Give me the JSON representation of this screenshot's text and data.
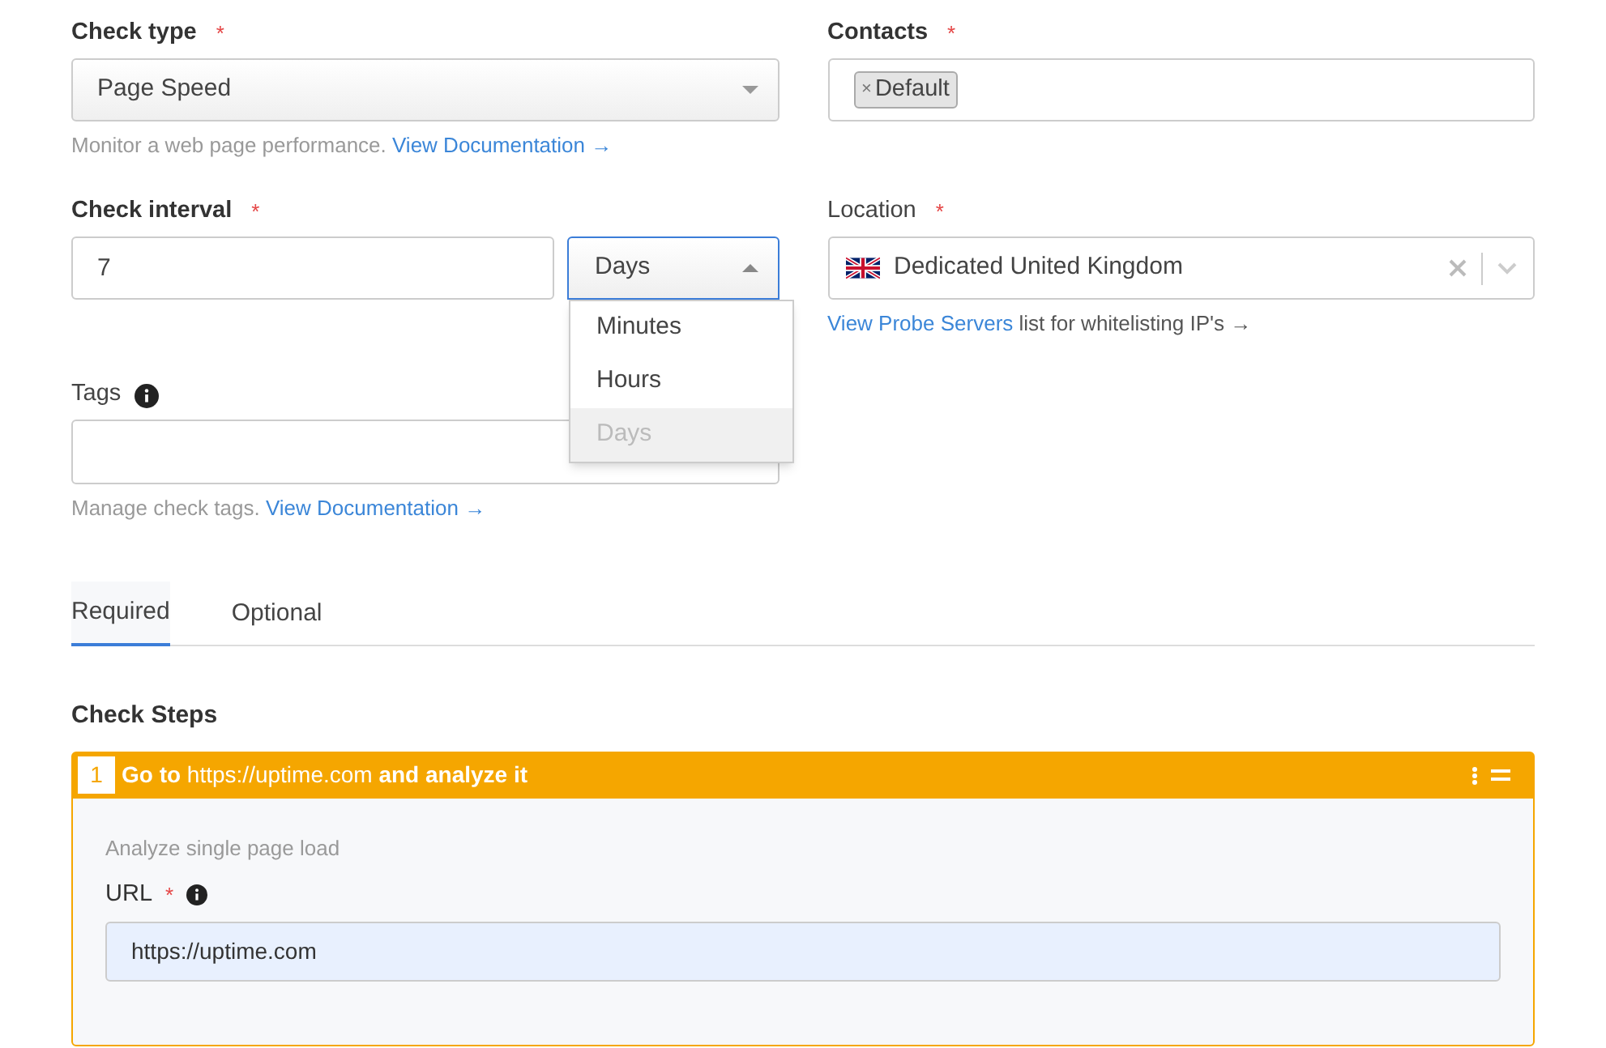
{
  "check_type": {
    "label": "Check type",
    "required": "*",
    "value": "Page Speed",
    "help": "Monitor a web page performance.",
    "help_link": "View Documentation →"
  },
  "contacts": {
    "label": "Contacts",
    "required": "*",
    "tags": [
      {
        "remove": "×",
        "label": "Default"
      }
    ]
  },
  "check_interval": {
    "label": "Check interval",
    "required": "*",
    "value": "7",
    "unit": "Days",
    "expanded": true,
    "options": [
      {
        "label": "Minutes",
        "selected": false
      },
      {
        "label": "Hours",
        "selected": false
      },
      {
        "label": "Days",
        "selected": true
      }
    ]
  },
  "location": {
    "label": "Location",
    "required": "*",
    "value": "Dedicated United Kingdom",
    "help_link": "View Probe Servers",
    "help": "list for whitelisting IP's →"
  },
  "tags": {
    "label": "Tags",
    "help": "Manage check tags.",
    "help_link": "View Documentation →"
  },
  "tabs": [
    {
      "label": "Required",
      "selected": true
    },
    {
      "label": "Optional",
      "selected": false
    }
  ],
  "check_steps": {
    "title": "Check Steps",
    "steps": [
      {
        "number": "1",
        "title": "**Go to** https://uptime.com **and analyze it**",
        "description": "Analyze single page load",
        "field_label": "URL",
        "required": "*",
        "value": "https://uptime.com"
      }
    ]
  }
}
